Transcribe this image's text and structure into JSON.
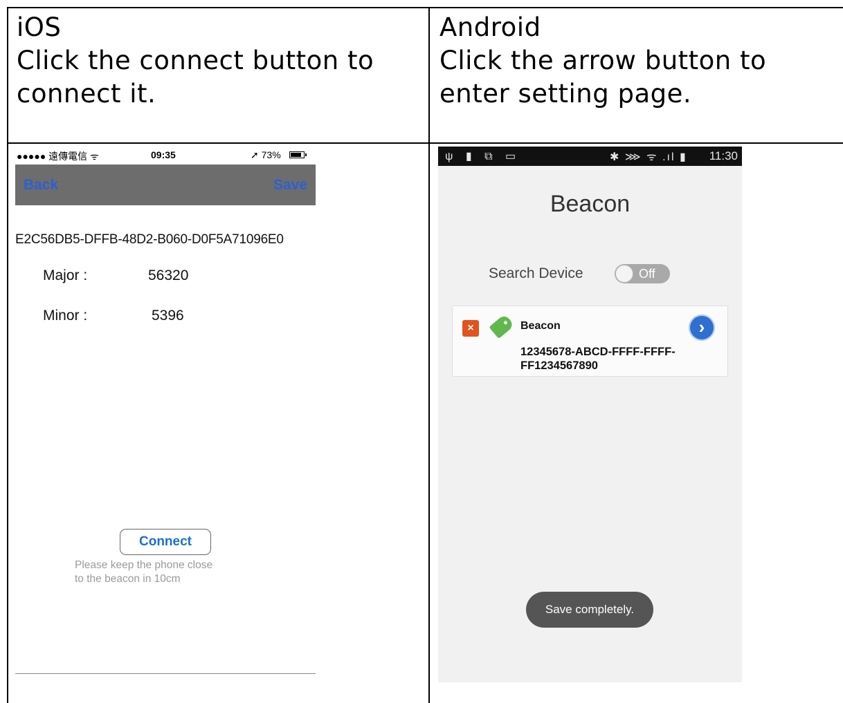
{
  "header": {
    "ios_col": {
      "platform": "iOS",
      "instruction_line1": "Click the connect button to",
      "instruction_line2": "connect it."
    },
    "android_col": {
      "platform": "Android",
      "instruction_line1": "Click the arrow button to",
      "instruction_line2": "enter setting page."
    }
  },
  "ios_screen": {
    "status": {
      "carrier": "●●●●● 遠傳電信 ᯤ",
      "time": "09:35",
      "battery": "➚ 73%"
    },
    "nav": {
      "back_label": "Back",
      "save_label": "Save"
    },
    "uuid": "E2C56DB5-DFFB-48D2-B060-D0F5A71096E0",
    "major_label": "Major :",
    "major_value": "56320",
    "minor_label": "Minor :",
    "minor_value": "5396",
    "connect_label": "Connect",
    "hint_line1": "Please keep the phone close",
    "hint_line2": "to the beacon in 10cm"
  },
  "android_screen": {
    "status": {
      "left_icons": "ψ ▮ ⧉ ▭",
      "right_icons": "✱ ⋙ ᯤ .ıl ▮",
      "time": "11:30"
    },
    "title": "Beacon",
    "search_label": "Search Device",
    "toggle_label": "Off",
    "device": {
      "name": "Beacon",
      "uuid": "12345678-ABCD-FFFF-FFFF-FF1234567890",
      "close_glyph": "×",
      "arrow_glyph": "›"
    },
    "toast": "Save completely."
  },
  "colors": {
    "ios_nav_bg": "#6d6d6d",
    "ios_link": "#2e5fd3",
    "android_arrow": "#2f6fd0",
    "android_close": "#e0531f",
    "android_tag": "#5fb84d"
  }
}
